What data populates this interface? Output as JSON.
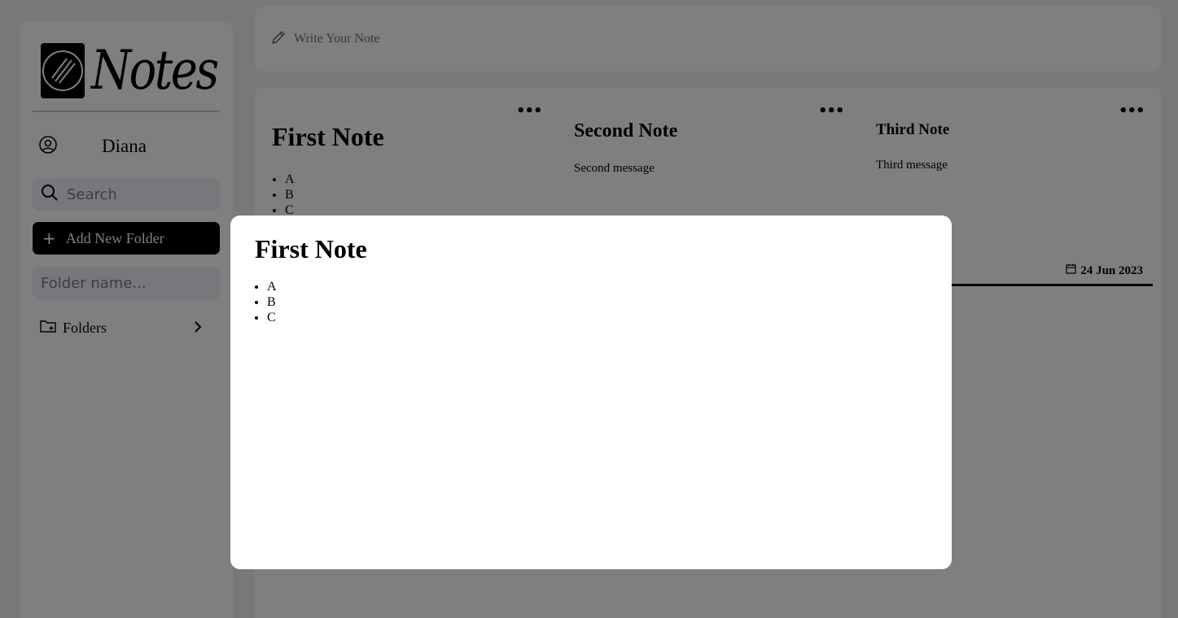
{
  "app": {
    "logo_text": "Notes"
  },
  "sidebar": {
    "user_name": "Diana",
    "search_placeholder": "Search",
    "add_folder_label": "Add New Folder",
    "folder_name_placeholder": "Folder name...",
    "folders_label": "Folders"
  },
  "compose": {
    "placeholder": "Write Your Note"
  },
  "notes": [
    {
      "title": "First Note",
      "items": [
        "A",
        "B",
        "C"
      ]
    },
    {
      "title": "Second Note",
      "message": "Second message"
    },
    {
      "title": "Third Note",
      "message": "Third message",
      "date": "24 Jun 2023"
    }
  ],
  "modal": {
    "title": "First Note",
    "items": [
      "A",
      "B",
      "C"
    ]
  },
  "icons": {
    "logo": "logo-mark-icon",
    "user": "user-circle-icon",
    "search": "search-icon",
    "add": "plus-icon",
    "folder": "folder-plus-icon",
    "chevron": "chevron-right-icon",
    "compose": "pencil-icon",
    "menu": "more-dots-icon",
    "date": "calendar-icon"
  },
  "colors": {
    "overlay": "#808080",
    "accent": "#000000",
    "input_bg": "#eef0f7"
  }
}
